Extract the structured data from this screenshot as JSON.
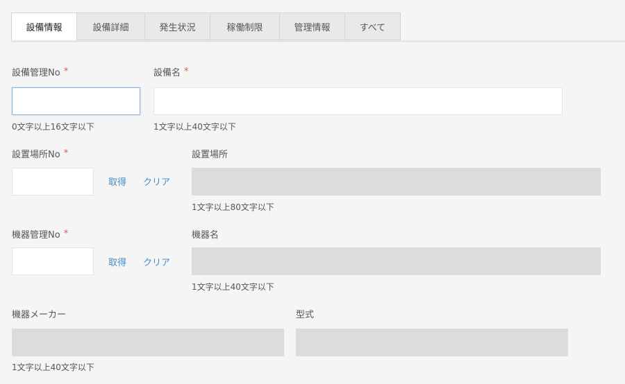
{
  "tabs": [
    {
      "label": "設備情報",
      "active": true
    },
    {
      "label": "設備詳細",
      "active": false
    },
    {
      "label": "発生状況",
      "active": false
    },
    {
      "label": "稼働制限",
      "active": false
    },
    {
      "label": "管理情報",
      "active": false
    },
    {
      "label": "すべて",
      "active": false
    }
  ],
  "required_mark": "*",
  "fields": {
    "equipment_mgmt_no": {
      "label": "設備管理No",
      "value": "",
      "hint": "0文字以上16文字以下"
    },
    "equipment_name": {
      "label": "設備名",
      "value": "",
      "hint": "1文字以上40文字以下"
    },
    "location_no": {
      "label": "設置場所No",
      "value": ""
    },
    "location": {
      "label": "設置場所",
      "value": "",
      "hint": "1文字以上80文字以下"
    },
    "device_mgmt_no": {
      "label": "機器管理No",
      "value": ""
    },
    "device_name": {
      "label": "機器名",
      "value": "",
      "hint": "1文字以上40文字以下"
    },
    "device_maker": {
      "label": "機器メーカー",
      "value": "",
      "hint": "1文字以上40文字以下"
    },
    "model": {
      "label": "型式",
      "value": ""
    }
  },
  "actions": {
    "fetch_label": "取得",
    "clear_label": "クリア"
  },
  "colors": {
    "required": "#e05a4e",
    "link": "#4a8ac4",
    "readonly_bg": "#dcdcdc",
    "focus_border": "#8fb1d6"
  }
}
